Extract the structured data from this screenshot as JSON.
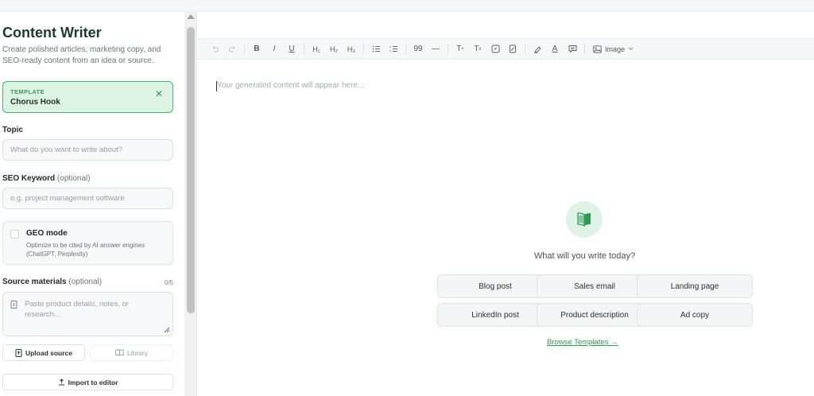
{
  "sidebar": {
    "title": "Content Writer",
    "subtitle": "Create polished articles, marketing copy, and SEO-ready content from an idea or source.",
    "template": {
      "label": "TEMPLATE",
      "name": "Chorus Hook"
    },
    "topic": {
      "label": "Topic",
      "placeholder": "What do you want to write about?"
    },
    "seo": {
      "label": "SEO Keyword",
      "optional": "(optional)",
      "placeholder": "e.g. project management software"
    },
    "geo": {
      "title": "GEO mode",
      "description": "Optimize to be cited by AI answer engines (ChatGPT, Perplexity)"
    },
    "source": {
      "label": "Source materials",
      "optional": "(optional)",
      "count": "0/5",
      "placeholder": "Paste product details, notes, or research..."
    },
    "upload_label": "Upload source",
    "library_label": "Library",
    "import_label": "Import to editor"
  },
  "toolbar": {
    "h1": "H₁",
    "h2": "H₂",
    "h3": "H₃",
    "quote": "99",
    "image_label": "Image"
  },
  "editor": {
    "placeholder": "Your generated content will appear here...",
    "prompt": "What will you write today?",
    "chips": [
      "Blog post",
      "Sales email",
      "Landing page",
      "LinkedIn post",
      "Product description",
      "Ad copy"
    ],
    "browse_label": "Browse Templates →"
  },
  "colors": {
    "accent": "#2f9a58",
    "template_bg": "#dcf2e3",
    "template_border": "#48b36e"
  }
}
